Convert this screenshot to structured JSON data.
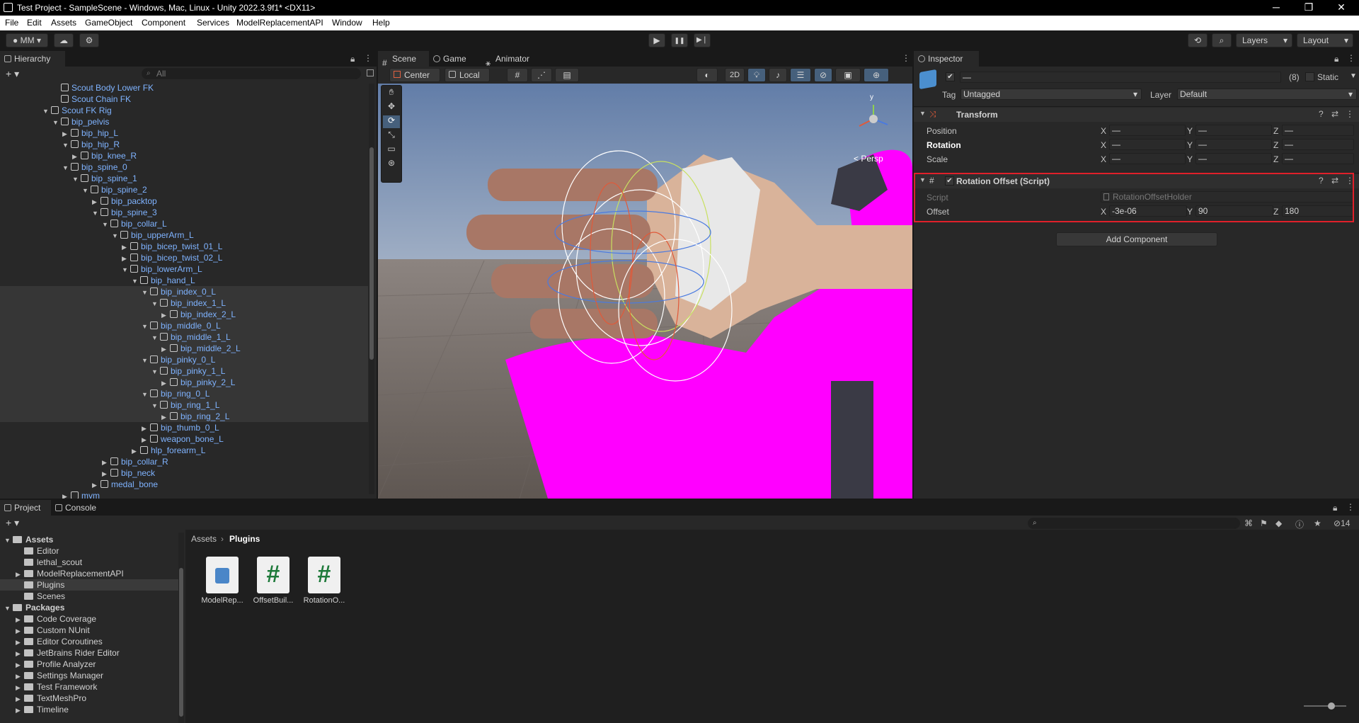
{
  "window": {
    "title": "Test Project - SampleScene - Windows, Mac, Linux - Unity 2022.3.9f1* <DX11>",
    "min": "─",
    "max": "❐",
    "close": "✕"
  },
  "menu": [
    "File",
    "Edit",
    "Assets",
    "GameObject",
    "Component",
    "Services",
    "ModelReplacementAPI",
    "Window",
    "Help"
  ],
  "toolbar": {
    "account": "MM",
    "play": "▶",
    "pause": "❚❚",
    "step": "▶❘",
    "layers": "Layers",
    "layout": "Layout"
  },
  "hierarchy": {
    "tab": "Hierarchy",
    "search_placeholder": "All",
    "rows": [
      {
        "label": "Scout Body Lower FK",
        "indent": 5,
        "arrow": ""
      },
      {
        "label": "Scout Chain FK",
        "indent": 5,
        "arrow": ""
      },
      {
        "label": "Scout FK Rig",
        "indent": 4,
        "arrow": "▼"
      },
      {
        "label": "bip_pelvis",
        "indent": 5,
        "arrow": "▼"
      },
      {
        "label": "bip_hip_L",
        "indent": 6,
        "arrow": "▶"
      },
      {
        "label": "bip_hip_R",
        "indent": 6,
        "arrow": "▼"
      },
      {
        "label": "bip_knee_R",
        "indent": 7,
        "arrow": "▶"
      },
      {
        "label": "bip_spine_0",
        "indent": 6,
        "arrow": "▼"
      },
      {
        "label": "bip_spine_1",
        "indent": 7,
        "arrow": "▼"
      },
      {
        "label": "bip_spine_2",
        "indent": 8,
        "arrow": "▼"
      },
      {
        "label": "bip_packtop",
        "indent": 9,
        "arrow": "▶"
      },
      {
        "label": "bip_spine_3",
        "indent": 9,
        "arrow": "▼"
      },
      {
        "label": "bip_collar_L",
        "indent": 10,
        "arrow": "▼"
      },
      {
        "label": "bip_upperArm_L",
        "indent": 11,
        "arrow": "▼"
      },
      {
        "label": "bip_bicep_twist_01_L",
        "indent": 12,
        "arrow": "▶"
      },
      {
        "label": "bip_bicep_twist_02_L",
        "indent": 12,
        "arrow": "▶"
      },
      {
        "label": "bip_lowerArm_L",
        "indent": 12,
        "arrow": "▼"
      },
      {
        "label": "bip_hand_L",
        "indent": 13,
        "arrow": "▼"
      },
      {
        "label": "bip_index_0_L",
        "indent": 14,
        "arrow": "▼",
        "sel": true
      },
      {
        "label": "bip_index_1_L",
        "indent": 15,
        "arrow": "▼",
        "sel": true
      },
      {
        "label": "bip_index_2_L",
        "indent": 16,
        "arrow": "▶",
        "sel": true
      },
      {
        "label": "bip_middle_0_L",
        "indent": 14,
        "arrow": "▼",
        "sel": true
      },
      {
        "label": "bip_middle_1_L",
        "indent": 15,
        "arrow": "▼",
        "sel": true
      },
      {
        "label": "bip_middle_2_L",
        "indent": 16,
        "arrow": "▶",
        "sel": true
      },
      {
        "label": "bip_pinky_0_L",
        "indent": 14,
        "arrow": "▼",
        "sel": true
      },
      {
        "label": "bip_pinky_1_L",
        "indent": 15,
        "arrow": "▼",
        "sel": true
      },
      {
        "label": "bip_pinky_2_L",
        "indent": 16,
        "arrow": "▶",
        "sel": true
      },
      {
        "label": "bip_ring_0_L",
        "indent": 14,
        "arrow": "▼",
        "sel": true
      },
      {
        "label": "bip_ring_1_L",
        "indent": 15,
        "arrow": "▼",
        "sel": true
      },
      {
        "label": "bip_ring_2_L",
        "indent": 16,
        "arrow": "▶",
        "sel": true
      },
      {
        "label": "bip_thumb_0_L",
        "indent": 14,
        "arrow": "▶"
      },
      {
        "label": "weapon_bone_L",
        "indent": 14,
        "arrow": "▶"
      },
      {
        "label": "hlp_forearm_L",
        "indent": 13,
        "arrow": "▶"
      },
      {
        "label": "bip_collar_R",
        "indent": 10,
        "arrow": "▶"
      },
      {
        "label": "bip_neck",
        "indent": 10,
        "arrow": "▶"
      },
      {
        "label": "medal_bone",
        "indent": 9,
        "arrow": "▶"
      },
      {
        "label": "mvm",
        "indent": 6,
        "arrow": "▶"
      }
    ]
  },
  "scene": {
    "tabs": [
      "Scene",
      "Game",
      "Animator"
    ],
    "pivot": "Center",
    "space": "Local",
    "mode2d": "2D",
    "persp": "< Persp",
    "gizmo_y": "y"
  },
  "inspector": {
    "tab": "Inspector",
    "name_value": "—",
    "count": "(8)",
    "static_label": "Static",
    "tag_label": "Tag",
    "tag_value": "Untagged",
    "layer_label": "Layer",
    "layer_value": "Default",
    "transform": {
      "title": "Transform",
      "rows": [
        {
          "label": "Position",
          "x": "—",
          "y": "—",
          "z": "—"
        },
        {
          "label": "Rotation",
          "x": "—",
          "y": "—",
          "z": "—"
        },
        {
          "label": "Scale",
          "x": "—",
          "y": "—",
          "z": "—"
        }
      ]
    },
    "rotation_offset": {
      "title": "Rotation Offset (Script)",
      "script_label": "Script",
      "script_value": "RotationOffsetHolder",
      "offset_label": "Offset",
      "x": "-3e-06",
      "y": "90",
      "z": "180"
    },
    "add_component": "Add Component",
    "axis": {
      "x": "X",
      "y": "Y",
      "z": "Z"
    }
  },
  "project": {
    "tabs": [
      "Project",
      "Console"
    ],
    "breadcrumb_root": "Assets",
    "breadcrumb_current": "Plugins",
    "hidden_count": "14",
    "tree": [
      {
        "label": "Assets",
        "indent": 0,
        "bold": true,
        "arrow": "▼"
      },
      {
        "label": "Editor",
        "indent": 1,
        "arrow": ""
      },
      {
        "label": "lethal_scout",
        "indent": 1,
        "arrow": ""
      },
      {
        "label": "ModelReplacementAPI",
        "indent": 1,
        "arrow": "▶"
      },
      {
        "label": "Plugins",
        "indent": 1,
        "arrow": "",
        "sel": true
      },
      {
        "label": "Scenes",
        "indent": 1,
        "arrow": ""
      },
      {
        "label": "Packages",
        "indent": 0,
        "bold": true,
        "arrow": "▼"
      },
      {
        "label": "Code Coverage",
        "indent": 1,
        "arrow": "▶"
      },
      {
        "label": "Custom NUnit",
        "indent": 1,
        "arrow": "▶"
      },
      {
        "label": "Editor Coroutines",
        "indent": 1,
        "arrow": "▶"
      },
      {
        "label": "JetBrains Rider Editor",
        "indent": 1,
        "arrow": "▶"
      },
      {
        "label": "Profile Analyzer",
        "indent": 1,
        "arrow": "▶"
      },
      {
        "label": "Settings Manager",
        "indent": 1,
        "arrow": "▶"
      },
      {
        "label": "Test Framework",
        "indent": 1,
        "arrow": "▶"
      },
      {
        "label": "TextMeshPro",
        "indent": 1,
        "arrow": "▶"
      },
      {
        "label": "Timeline",
        "indent": 1,
        "arrow": "▶"
      }
    ],
    "assets": [
      {
        "label": "ModelRep...",
        "kind": "dll"
      },
      {
        "label": "OffsetBuil...",
        "kind": "script"
      },
      {
        "label": "RotationO...",
        "kind": "script"
      }
    ]
  },
  "colors": {
    "highlight": "#e0202a",
    "magenta": "#ff00ff",
    "link": "#7fb3ff"
  }
}
